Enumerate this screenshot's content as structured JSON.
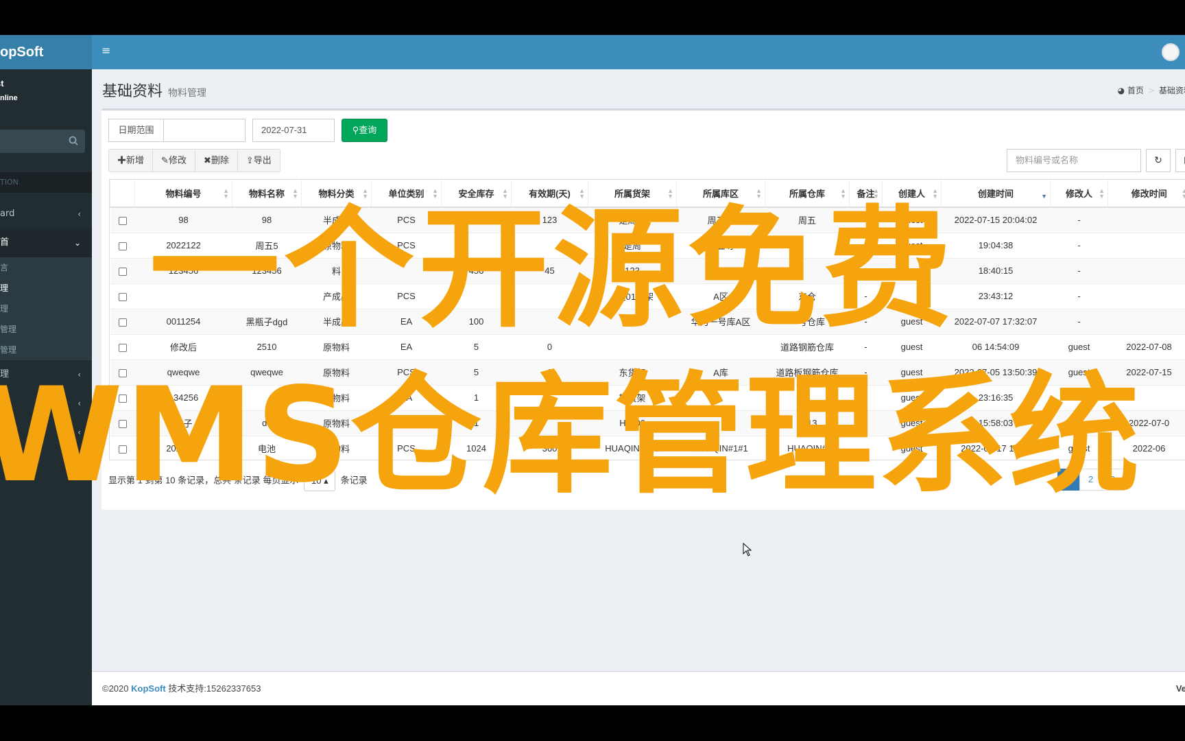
{
  "colors": {
    "header": "#3c8dbc",
    "sidebar": "#222d32",
    "query": "#00a65a",
    "overlay": "#f5a40d",
    "pageActive": "#337ab7"
  },
  "brand": {
    "logo": "opSoft"
  },
  "user": {
    "name": "st",
    "status": "nline"
  },
  "sidebar": {
    "header": "TION",
    "items": [
      {
        "label": "ard",
        "chev": "‹"
      },
      {
        "label": "首",
        "chev": "⌄"
      }
    ],
    "submenu": [
      "言",
      "理",
      "理",
      "管理",
      "管理"
    ],
    "items_after": [
      {
        "label": "理",
        "chev": "‹"
      },
      {
        "label": "理",
        "chev": "‹"
      },
      {
        "label": "-",
        "chev": "‹"
      }
    ]
  },
  "header": {
    "menu_icon": "≡"
  },
  "page": {
    "title": "基础资料",
    "subtitle": "物料管理"
  },
  "breadcrumb": {
    "home": "首页",
    "current": "基础资料"
  },
  "filter": {
    "date_label": "日期范围",
    "date_from": "",
    "date_to": "2022-07-31",
    "query_label": "查询"
  },
  "toolbar": {
    "add": "新增",
    "edit": "修改",
    "delete": "删除",
    "export": "导出"
  },
  "search": {
    "placeholder": "物料编号或名称"
  },
  "table": {
    "columns": [
      "物料编号",
      "物料名称",
      "物料分类",
      "单位类别",
      "安全库存",
      "有效期(天)",
      "所属货架",
      "所属库区",
      "所属仓库",
      "备注",
      "创建人",
      "创建时间",
      "修改人",
      "修改时间"
    ],
    "rows": [
      [
        "98",
        "98",
        "半成品",
        "PCS",
        "123",
        "123",
        "是周五",
        "周五呀",
        "周五",
        "-",
        "guest",
        "2022-07-15 20:04:02",
        "-",
        ""
      ],
      [
        "2022122",
        "周五5",
        "原物料",
        "PCS",
        "",
        "",
        "是周",
        "周五呀",
        "",
        "-",
        "guest",
        "19:04:38",
        "-",
        ""
      ],
      [
        "123456",
        "123456",
        "料",
        "",
        "456",
        "45",
        "123",
        "23456",
        "",
        "-",
        "",
        "18:40:15",
        "-",
        ""
      ],
      [
        "",
        "",
        "产成品",
        "PCS",
        "",
        "",
        "A区01货架",
        "A区",
        "东仓",
        "-",
        "",
        "23:43:12",
        "-",
        ""
      ],
      [
        "0011254",
        "黑瓶子dgd",
        "半成品",
        "EA",
        "100",
        "",
        "",
        "华为一号库A区",
        "一号仓库",
        "-",
        "guest",
        "2022-07-07 17:32:07",
        "-",
        ""
      ],
      [
        "修改后",
        "2510",
        "原物料",
        "EA",
        "5",
        "0",
        "",
        "",
        "道路钢筋仓库",
        "-",
        "guest",
        "06 14:54:09",
        "guest",
        "2022-07-08"
      ],
      [
        "qweqwe",
        "qweqwe",
        "原物料",
        "PCS",
        "5",
        "1",
        "东货架",
        "A库",
        "道路板钢筋仓库",
        "-",
        "guest",
        "2022-07-05 13:50:39",
        "guest",
        "2022-07-15"
      ],
      [
        "134256",
        "",
        "原物料",
        "EA",
        "1",
        "",
        "转货架",
        "",
        "",
        "",
        "guest",
        "23:16:35",
        "",
        ""
      ],
      [
        "车子",
        "ds",
        "原物料",
        "PCS",
        "1",
        "",
        "HJ_06",
        "",
        "0613",
        "",
        "guest",
        "15:58:03",
        "",
        "2022-07-0"
      ],
      [
        "2020179",
        "电池",
        "原物料",
        "PCS",
        "1024",
        "360",
        "HUAQIN#1#1",
        "HUAQIN#1#1",
        "HUAQIN#",
        "",
        "guest",
        "2022-06-17 11:08",
        "guest",
        "2022-06"
      ]
    ]
  },
  "pager": {
    "info_start": "显示第 1 到第 10 条记录，总共 ",
    "info_mid": " 条记录 每页显示 ",
    "page_size": "10",
    "info_end": " 条记录",
    "pages": [
      "1",
      "2",
      "3"
    ]
  },
  "footer": {
    "copyright": "©2020 ",
    "brand": "KopSoft",
    "support": " 技术支持:15262337653",
    "version": "Ve"
  },
  "overlay": {
    "line1": "一个开源免费",
    "line2": "WMS仓库管理系统"
  }
}
